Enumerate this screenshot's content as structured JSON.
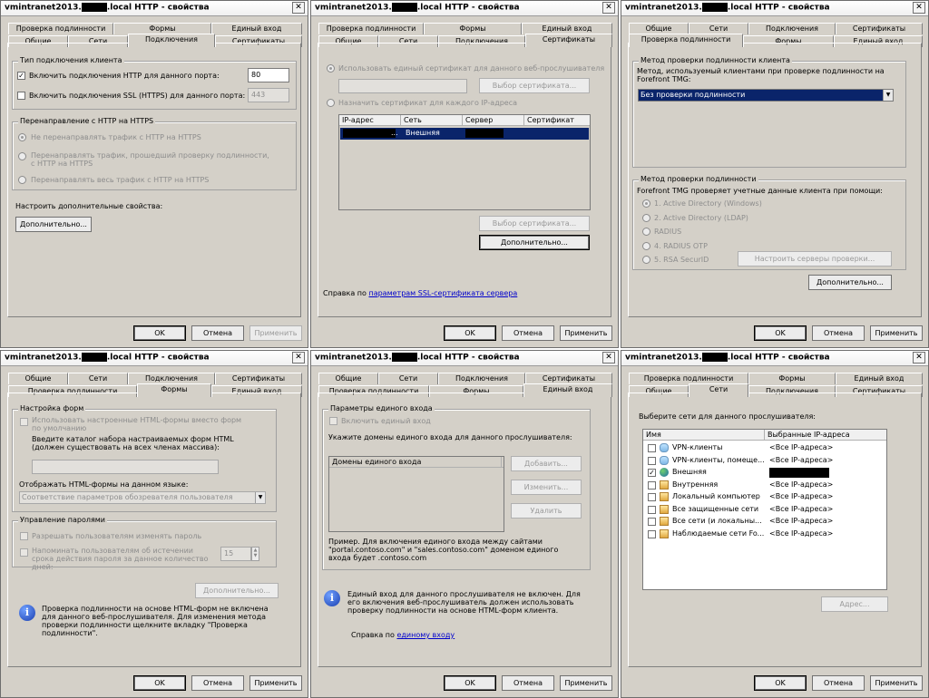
{
  "window_title": "vmintranet2013.",
  "window_title_suffix": ".local HTTP - свойства",
  "tabs": {
    "auth": "Проверка подлинности",
    "forms": "Формы",
    "sso": "Единый вход",
    "general": "Общие",
    "networks": "Сети",
    "connections": "Подключения",
    "certificates": "Сертификаты"
  },
  "buttons": {
    "ok": "OK",
    "cancel": "Отмена",
    "apply": "Применить"
  },
  "conn": {
    "client_type": "Тип подключения клиента",
    "http_enable": "Включить подключения HTTP для данного порта:",
    "http_port": "80",
    "ssl_enable": "Включить подключения SSL (HTTPS) для данного порта:",
    "ssl_port": "443",
    "redirect_group": "Перенаправление с HTTP на HTTPS",
    "r1": "Не перенаправлять трафик с HTTP на HTTPS",
    "r2": "Перенаправлять трафик, прошедший проверку подлинности, с HTTP на HTTPS",
    "r3": "Перенаправлять весь трафик с HTTP на HTTPS",
    "more_props": "Настроить дополнительные свойства:",
    "advanced": "Дополнительно..."
  },
  "cert": {
    "single": "Использовать единый сертификат для данного веб-прослушивателя",
    "choose": "Выбор сертификата...",
    "per_ip": "Назначить сертификат для каждого IP-адреса",
    "cols": [
      "IP-адрес",
      "Сеть",
      "Сервер",
      "Сертификат"
    ],
    "row_network": "Внешняя",
    "choose2": "Выбор сертификата...",
    "advanced": "Дополнительно...",
    "help_prefix": "Справка по ",
    "help_link": "параметрам SSL-сертификата сервера"
  },
  "auth": {
    "group1": "Метод проверки подлинности клиента",
    "desc1": "Метод, используемый клиентами при проверке подлинности на Forefront TMG:",
    "method": "Без проверки подлинности",
    "group2": "Метод проверки подлинности",
    "desc2": "Forefront TMG проверяет учетные данные клиента при помощи:",
    "opt1": "1. Active Directory (Windows)",
    "opt2": "2. Active Directory (LDAP)",
    "opt3": "RADIUS",
    "opt4": "4. RADIUS OTP",
    "opt5": "5. RSA SecurID",
    "servers": "Настроить серверы проверки...",
    "advanced": "Дополнительно..."
  },
  "forms": {
    "group1": "Настройка форм",
    "custom": "Использовать настроенные HTML-формы вместо форм по умолчанию",
    "dir_label": "Введите каталог набора настраиваемых форм HTML (должен существовать на всех членах массива):",
    "lang_label": "Отображать HTML-формы на данном языке:",
    "lang_value": "Соответствие параметров обозревателя пользователя",
    "group2": "Управление паролями",
    "allow_change": "Разрешать пользователям изменять пароль",
    "remind": "Напоминать пользователям об истечении срока действия пароля за данное количество дней:",
    "days": "15",
    "advanced": "Дополнительно...",
    "info": "Проверка подлинности на основе HTML-форм не включена для данного веб-прослушивателя. Для изменения метода проверки подлинности щелкните вкладку \"Проверка подлинности\"."
  },
  "sso": {
    "group": "Параметры единого входа",
    "enable": "Включить единый вход",
    "domains_label": "Укажите домены единого входа для данного прослушивателя:",
    "col": "Домены единого входа",
    "add": "Добавить...",
    "edit": "Изменить...",
    "remove": "Удалить",
    "example": "Пример. Для включения единого входа между сайтами \"portal.contoso.com\" и \"sales.contoso.com\" доменом единого входа будет .contoso.com",
    "info": "Единый вход для данного прослушивателя не включен. Для его включения веб-прослушиватель должен использовать проверку подлинности на основе HTML-форм клиента.",
    "help_prefix": "Справка по ",
    "help_link": "единому входу"
  },
  "nets": {
    "label": "Выберите сети для данного прослушивателя:",
    "col_name": "Имя",
    "col_ip": "Выбранные IP-адреса",
    "rows": [
      {
        "name": "VPN-клиенты",
        "ip": "<Все IP-адреса>",
        "checked": false
      },
      {
        "name": "VPN-клиенты, помеще...",
        "ip": "<Все IP-адреса>",
        "checked": false
      },
      {
        "name": "Внешняя",
        "ip": "",
        "checked": true
      },
      {
        "name": "Внутренняя",
        "ip": "<Все IP-адреса>",
        "checked": false
      },
      {
        "name": "Локальный компьютер",
        "ip": "<Все IP-адреса>",
        "checked": false
      },
      {
        "name": "Все защищенные сети",
        "ip": "<Все IP-адреса>",
        "checked": false
      },
      {
        "name": "Все сети (и локальны...",
        "ip": "<Все IP-адреса>",
        "checked": false
      },
      {
        "name": "Наблюдаемые сети Fo...",
        "ip": "<Все IP-адреса>",
        "checked": false
      }
    ],
    "address": "Адрес..."
  }
}
